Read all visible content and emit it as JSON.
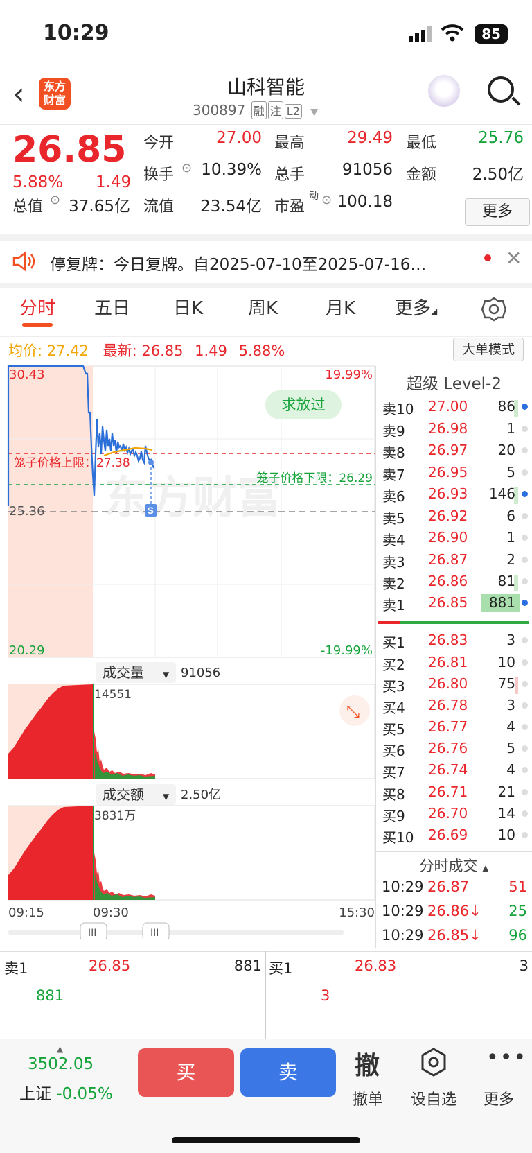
{
  "status": {
    "time": "10:29",
    "battery": "85"
  },
  "header": {
    "logo_line1": "东方",
    "logo_line2": "财富",
    "name": "山科智能",
    "code": "300897",
    "tags": [
      "融",
      "注",
      "L2"
    ]
  },
  "quote": {
    "price": "26.85",
    "change_pct": "5.88%",
    "change": "1.49",
    "open_label": "今开",
    "open": "27.00",
    "high_label": "最高",
    "high": "29.49",
    "low_label": "最低",
    "low": "25.76",
    "turnover_label": "换手",
    "turnover": "10.39%",
    "volume_label": "总手",
    "volume": "91056",
    "amount_label": "金额",
    "amount": "2.50亿",
    "mktcap_label": "总值",
    "mktcap": "37.65亿",
    "float_label": "流值",
    "float": "23.54亿",
    "pe_label": "市盈",
    "pe_sup": "动",
    "pe": "100.18",
    "more": "更多"
  },
  "notice": {
    "text": "停复牌：今日复牌。自2025-07-10至2025-07-16…"
  },
  "tabs": [
    "分时",
    "五日",
    "日K",
    "周K",
    "月K",
    "更多"
  ],
  "avgline": {
    "avg_label": "均价:",
    "avg": "27.42",
    "latest_label": "最新:",
    "latest": "26.85",
    "chg": "1.49",
    "pct": "5.88%",
    "big_order": "大单模式"
  },
  "chart": {
    "high": "30.43",
    "high_pct": "19.99%",
    "low": "20.29",
    "low_pct": "-19.99%",
    "prev_close": "25.36",
    "upper_cage": "笼子价格上限：27.38",
    "lower_cage": "笼子价格下限：26.29",
    "pill": "求放过",
    "watermark": "东方财富",
    "marker": "S",
    "vol_label": "成交量",
    "vol_total": "91056",
    "vol_peak": "14551",
    "amt_label": "成交额",
    "amt_total": "2.50亿",
    "amt_peak": "3831万",
    "t_start": "09:15",
    "t_mid": "09:30",
    "t_end": "15:30"
  },
  "level2": {
    "title": "超级 Level-2",
    "asks": [
      {
        "label": "卖10",
        "price": "27.00",
        "vol": "86"
      },
      {
        "label": "卖9",
        "price": "26.98",
        "vol": "1"
      },
      {
        "label": "卖8",
        "price": "26.97",
        "vol": "20"
      },
      {
        "label": "卖7",
        "price": "26.95",
        "vol": "5"
      },
      {
        "label": "卖6",
        "price": "26.93",
        "vol": "146"
      },
      {
        "label": "卖5",
        "price": "26.92",
        "vol": "6"
      },
      {
        "label": "卖4",
        "price": "26.90",
        "vol": "1"
      },
      {
        "label": "卖3",
        "price": "26.87",
        "vol": "2"
      },
      {
        "label": "卖2",
        "price": "26.86",
        "vol": "81"
      },
      {
        "label": "卖1",
        "price": "26.85",
        "vol": "881"
      }
    ],
    "bids": [
      {
        "label": "买1",
        "price": "26.83",
        "vol": "3"
      },
      {
        "label": "买2",
        "price": "26.81",
        "vol": "10"
      },
      {
        "label": "买3",
        "price": "26.80",
        "vol": "75"
      },
      {
        "label": "买4",
        "price": "26.78",
        "vol": "3"
      },
      {
        "label": "买5",
        "price": "26.77",
        "vol": "4"
      },
      {
        "label": "买6",
        "price": "26.76",
        "vol": "5"
      },
      {
        "label": "买7",
        "price": "26.74",
        "vol": "4"
      },
      {
        "label": "买8",
        "price": "26.71",
        "vol": "21"
      },
      {
        "label": "买9",
        "price": "26.70",
        "vol": "14"
      },
      {
        "label": "买10",
        "price": "26.69",
        "vol": "10"
      }
    ],
    "ticks_title": "分时成交",
    "ticks": [
      {
        "time": "10:29",
        "price": "26.87",
        "vol": "51"
      },
      {
        "time": "10:29",
        "price": "26.86↓",
        "vol": "25"
      },
      {
        "time": "10:29",
        "price": "26.85↓",
        "vol": "96"
      }
    ]
  },
  "bidask": {
    "ask_label": "卖1",
    "ask_price": "26.85",
    "ask_vol": "881",
    "bid_label": "买1",
    "bid_price": "26.83",
    "bid_vol": "3",
    "ask_queue": "881",
    "bid_queue": "3"
  },
  "footer": {
    "index_value": "3502.05",
    "index_name": "上证",
    "index_chg": "-0.05%",
    "buy": "买",
    "sell": "卖",
    "cancel_icon": "撤",
    "cancel": "撤单",
    "watch": "设自选",
    "more": "更多"
  },
  "colors": {
    "up": "#e8262b",
    "down": "#15a33a",
    "accent": "#f25022",
    "blue": "#3b78e6"
  }
}
